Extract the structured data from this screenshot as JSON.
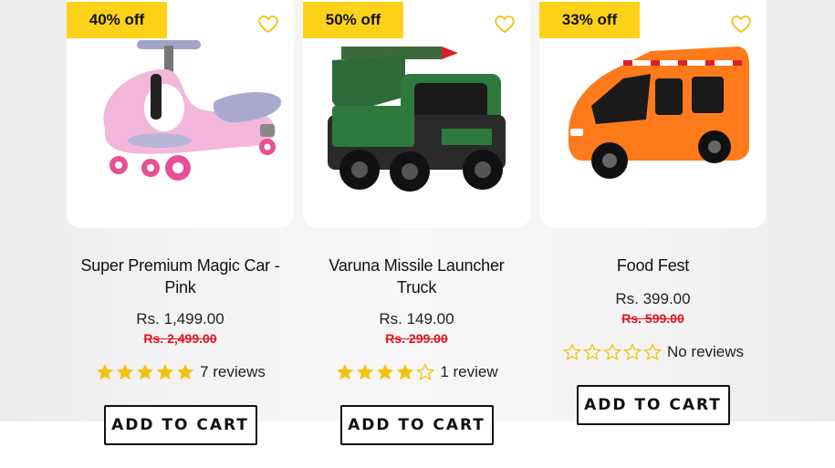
{
  "colors": {
    "badge": "#ffd21a",
    "star": "#f4c20d",
    "old_price": "#e0141e"
  },
  "products": [
    {
      "badge": "40% off",
      "title": "Super Premium Magic Car - Pink",
      "price": "Rs. 1,499.00",
      "old_price": "Rs. 2,499.00",
      "rating": 5,
      "reviews": "7 reviews",
      "button": "ADD TO CART",
      "image_icon": "pink-ride-on-car"
    },
    {
      "badge": "50% off",
      "title": "Varuna Missile Launcher Truck",
      "price": "Rs. 149.00",
      "old_price": "Rs. 299.00",
      "rating": 4,
      "reviews": "1 review",
      "button": "ADD TO CART",
      "image_icon": "missile-truck"
    },
    {
      "badge": "33% off",
      "title": "Food Fest",
      "price": "Rs. 399.00",
      "old_price": "Rs. 599.00",
      "rating": 0,
      "reviews": "No reviews",
      "button": "ADD TO CART",
      "image_icon": "orange-food-van"
    }
  ]
}
